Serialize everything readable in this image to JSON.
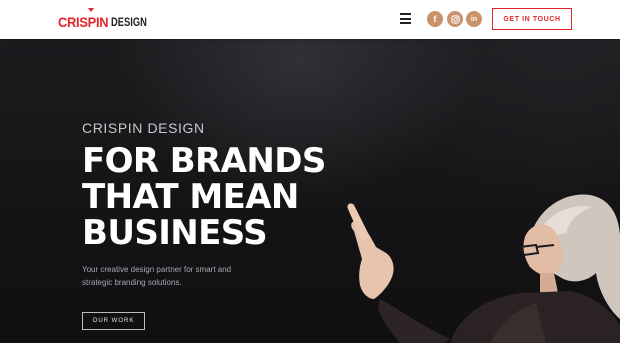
{
  "brand": {
    "logo_primary": "CRISPIN",
    "logo_secondary": "DESIGN",
    "accent_color": "#e2262c",
    "social_color": "#c8926b"
  },
  "header": {
    "menu_icon": "hamburger-icon",
    "social": [
      {
        "name": "facebook",
        "glyph": "f"
      },
      {
        "name": "instagram",
        "glyph": "instagram-icon"
      },
      {
        "name": "linkedin",
        "glyph": "in"
      }
    ],
    "cta_label": "GET IN TOUCH"
  },
  "hero": {
    "eyebrow": "CRISPIN DESIGN",
    "headline_lines": [
      "FOR BRANDS",
      "THAT MEAN",
      "BUSINESS"
    ],
    "subtext_lines": [
      "Your creative design partner for smart and",
      "strategic branding solutions."
    ],
    "button_label": "OUR WORK"
  }
}
